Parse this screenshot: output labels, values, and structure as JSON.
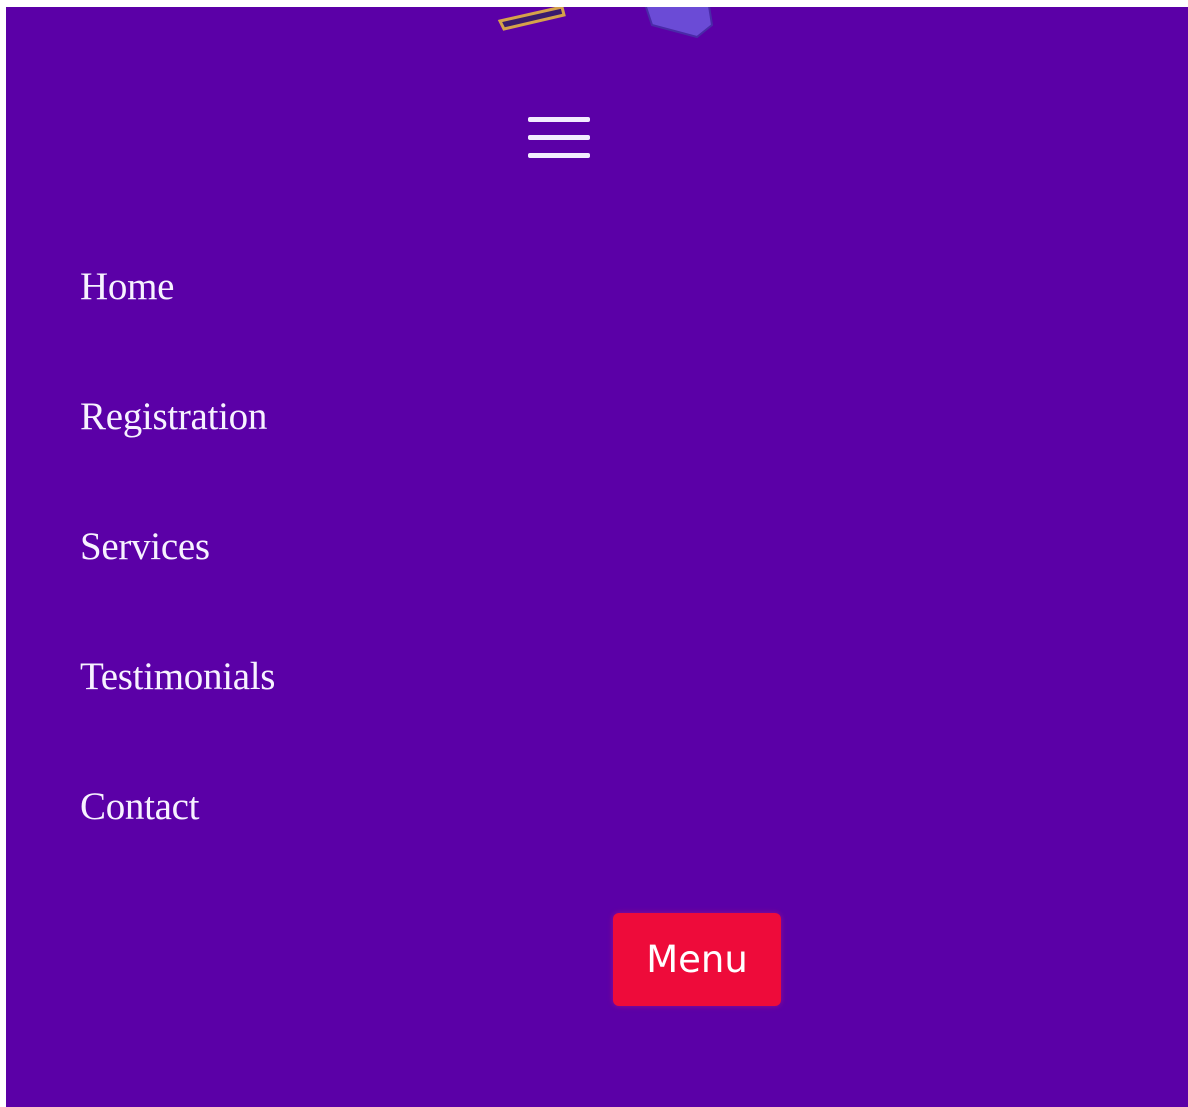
{
  "colors": {
    "background": "#5b00a7",
    "nav_text": "#f7f2ff",
    "button_background": "#ee0b3a",
    "button_text": "#ffffff",
    "hamburger": "#f3ecff"
  },
  "header": {
    "logo_icon": "logo-icon",
    "menu_toggle_icon": "hamburger-icon"
  },
  "nav": {
    "items": [
      {
        "label": "Home"
      },
      {
        "label": "Registration"
      },
      {
        "label": "Services"
      },
      {
        "label": "Testimonials"
      },
      {
        "label": "Contact"
      }
    ]
  },
  "menu_button": {
    "label": "Menu"
  }
}
